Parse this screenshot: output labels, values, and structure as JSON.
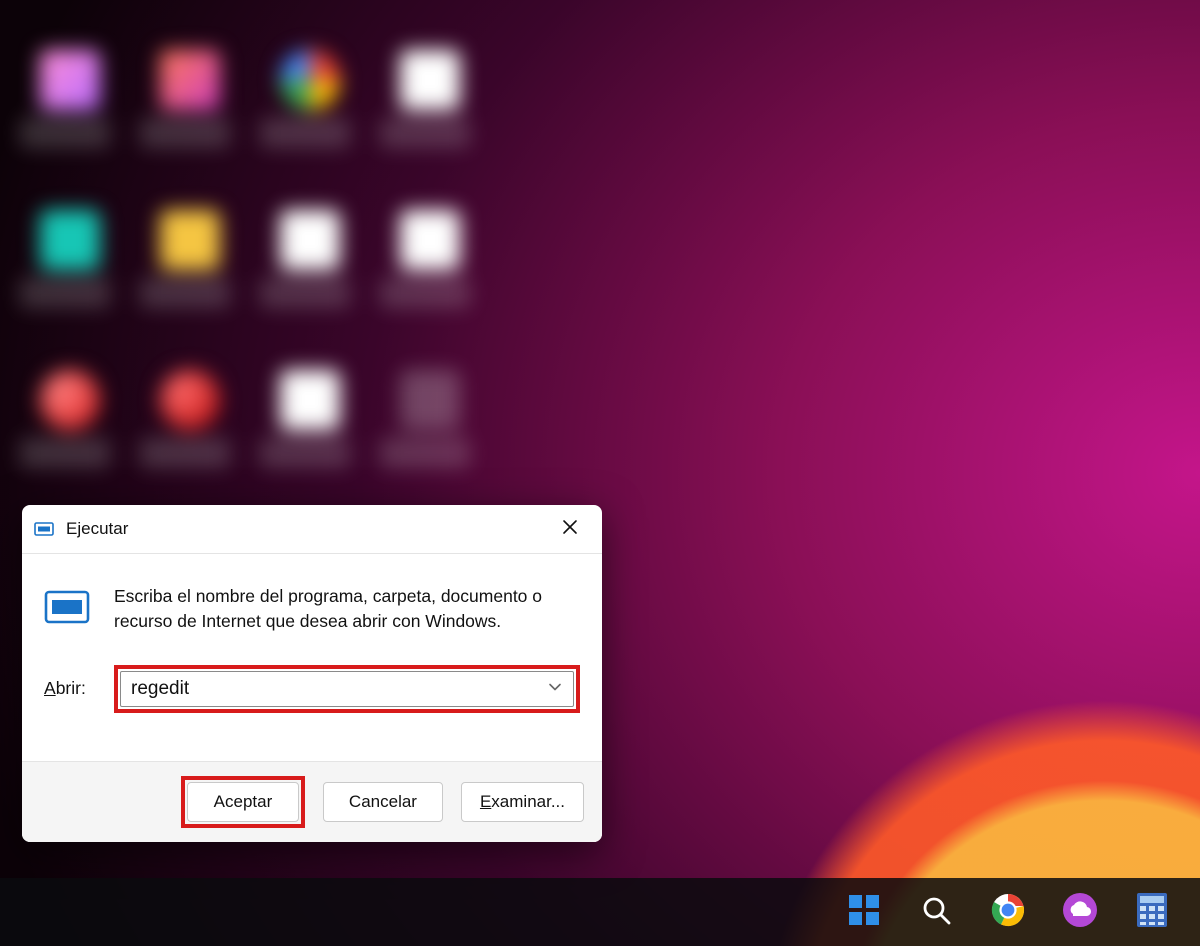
{
  "dialog": {
    "title": "Ejecutar",
    "description": "Escriba el nombre del programa, carpeta, documento o recurso de Internet que desea abrir con Windows.",
    "open_label_prefix": "A",
    "open_label_rest": "brir:",
    "input_value": "regedit",
    "buttons": {
      "ok": "Aceptar",
      "cancel": "Cancelar",
      "browse_prefix": "E",
      "browse_rest": "xaminar..."
    }
  },
  "taskbar": {
    "items": [
      {
        "name": "start"
      },
      {
        "name": "search"
      },
      {
        "name": "chrome"
      },
      {
        "name": "cloud"
      },
      {
        "name": "calculator"
      }
    ]
  }
}
